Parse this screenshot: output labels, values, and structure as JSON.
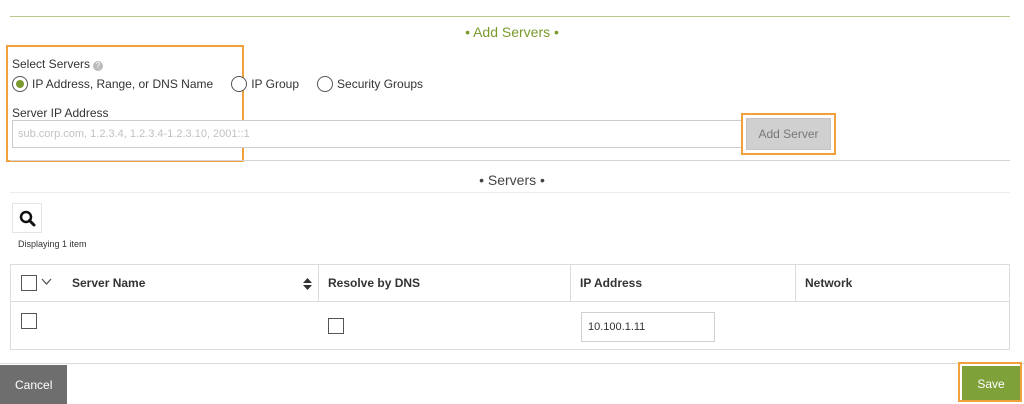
{
  "add_servers": {
    "title": "• Add Servers •",
    "select_label": "Select Servers",
    "help_icon": "?",
    "radios": [
      {
        "label": "IP Address, Range, or DNS Name",
        "checked": true
      },
      {
        "label": "IP Group",
        "checked": false
      },
      {
        "label": "Security Groups",
        "checked": false
      }
    ],
    "ip_label": "Server IP Address",
    "ip_placeholder": "sub.corp.com, 1.2.3.4, 1.2.3.4-1.2.3.10, 2001::1",
    "add_button": "Add Server"
  },
  "servers": {
    "title": "• Servers •",
    "displaying": "Displaying 1 item",
    "columns": [
      "Server Name",
      "Resolve by DNS",
      "IP Address",
      "Network"
    ],
    "rows": [
      {
        "server_name": "",
        "resolve_by_dns": false,
        "ip_address": "10.100.1.11",
        "network": ""
      }
    ]
  },
  "footer": {
    "cancel": "Cancel",
    "save": "Save"
  },
  "colors": {
    "accent": "#7a9a2e",
    "highlight": "#f0a13b",
    "save_bg": "#7fa13a",
    "cancel_bg": "#6e6e6e"
  }
}
